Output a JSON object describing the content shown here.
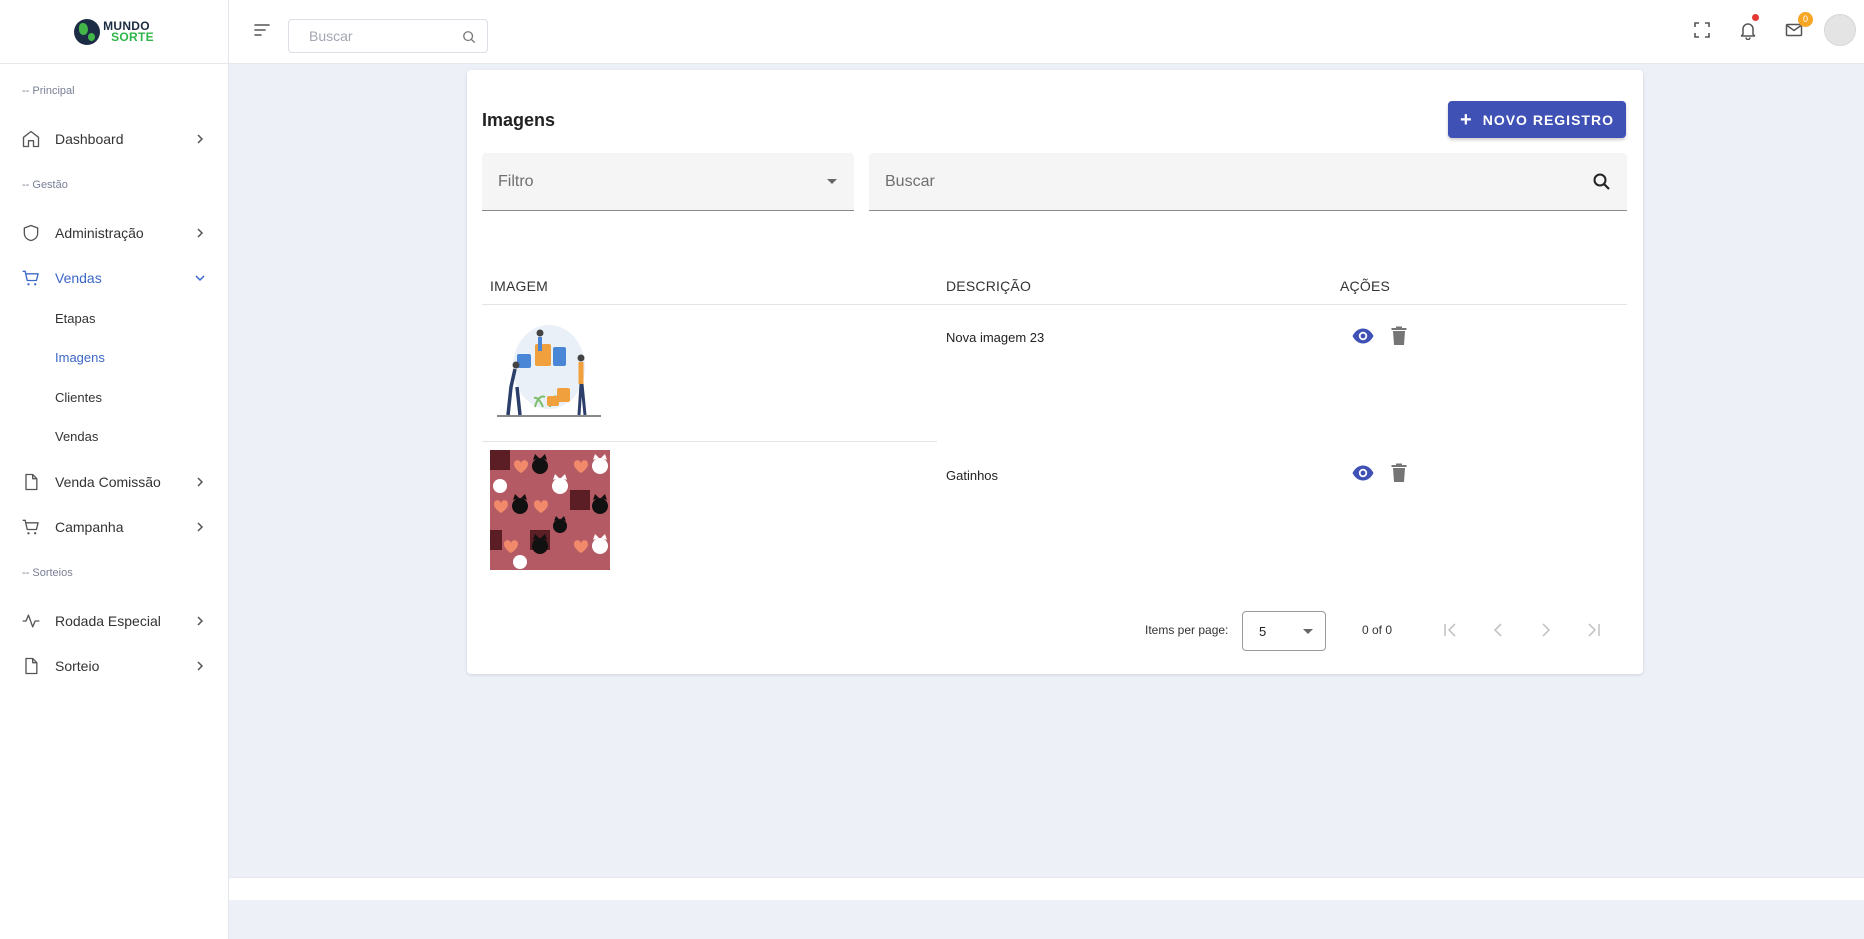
{
  "app": {
    "logo_line1": "MUNDO",
    "logo_line2": "SORTE",
    "brand_dark": "#1c2c44",
    "brand_green": "#2fb64a",
    "accent": "#3f51b5",
    "active_nav": "#3b67c8"
  },
  "sidebar": {
    "sections": [
      "-- Principal",
      "-- Gestão",
      "-- Sorteios"
    ],
    "items": [
      {
        "label": "Dashboard",
        "icon": "home-icon"
      },
      {
        "label": "Administração",
        "icon": "shield-icon"
      },
      {
        "label": "Vendas",
        "icon": "cart-icon",
        "expanded": true
      },
      {
        "label": "Venda Comissão",
        "icon": "file-icon"
      },
      {
        "label": "Campanha",
        "icon": "cart-icon"
      },
      {
        "label": "Rodada Especial",
        "icon": "activity-icon"
      },
      {
        "label": "Sorteio",
        "icon": "file-icon"
      }
    ],
    "subitems": [
      "Etapas",
      "Imagens",
      "Clientes",
      "Vendas"
    ],
    "active_subitem": "Imagens"
  },
  "topbar": {
    "search_placeholder": "Buscar",
    "mail_count": "0"
  },
  "page": {
    "title": "Imagens",
    "new_button": "NOVO REGISTRO",
    "filter_label": "Filtro",
    "search_label": "Buscar"
  },
  "table": {
    "columns": [
      "IMAGEM",
      "DESCRIÇÃO",
      "AÇÕES"
    ],
    "rows": [
      {
        "image": "puzzle-illustration",
        "description": "Nova imagem 23"
      },
      {
        "image": "cats-pattern",
        "description": "Gatinhos"
      }
    ]
  },
  "pagination": {
    "items_per_page_label": "Items per page:",
    "page_size": "5",
    "range": "0 of 0"
  }
}
